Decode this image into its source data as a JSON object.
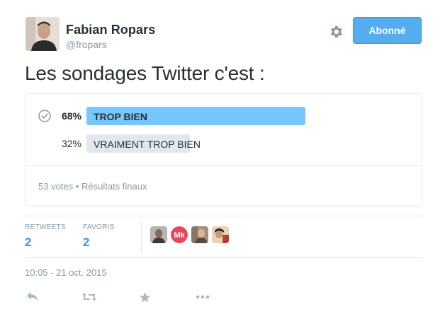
{
  "user": {
    "name": "Fabian Ropars",
    "handle": "@fropars"
  },
  "follow_button": {
    "label": "Abonné"
  },
  "tweet": {
    "text": "Les sondages Twitter c'est :"
  },
  "poll": {
    "options": [
      {
        "label": "TROP BIEN",
        "percent_text": "68%",
        "percent": 68,
        "winner": true
      },
      {
        "label": "VRAIMENT TROP BIEN",
        "percent_text": "32%",
        "percent": 32,
        "winner": false
      }
    ],
    "votes": "53 votes",
    "separator": "•",
    "status": "Résultats finaux"
  },
  "stats": {
    "retweets_label": "RETWEETS",
    "retweets_value": "2",
    "favorites_label": "FAVORIS",
    "favorites_value": "2"
  },
  "timestamp": "10:05 - 21 oct. 2015",
  "colors": {
    "accent": "#55acee",
    "poll_winner": "#77c7ff",
    "poll_other": "#e1e8ed",
    "muted_text": "#8899a6",
    "link": "#3b94d9",
    "mk_avatar": "#e8475a"
  },
  "icons": {
    "gear": "gear-icon",
    "check": "check-circle-icon",
    "reply": "reply-icon",
    "retweet": "retweet-icon",
    "favorite": "star-icon",
    "more": "more-icon"
  },
  "favoriters_avatar_text": "Mk"
}
